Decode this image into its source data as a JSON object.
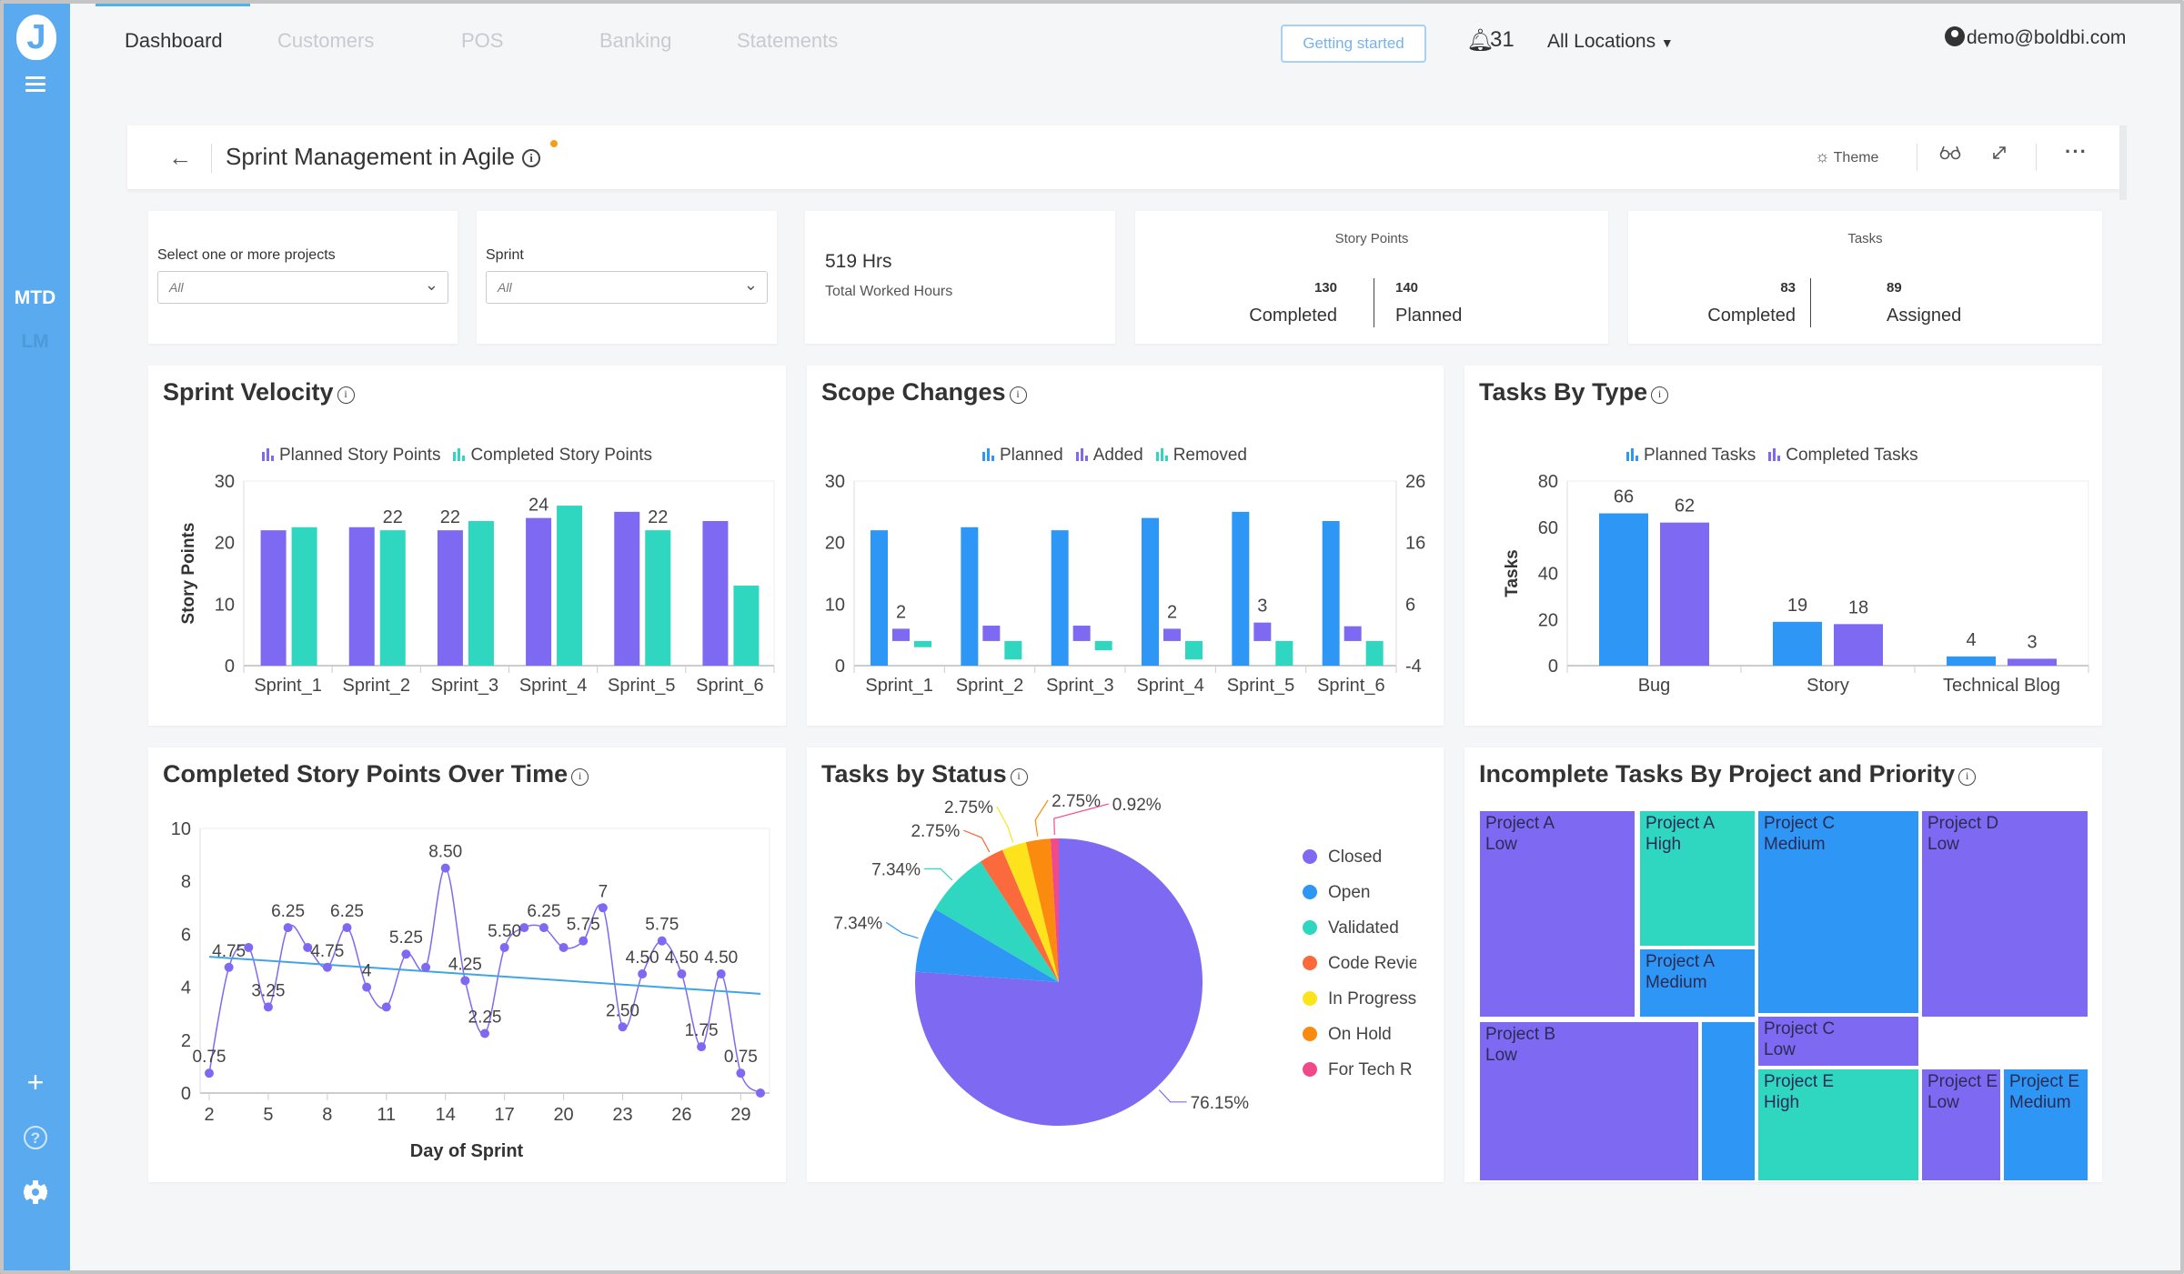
{
  "sidebar": {
    "logo_letter": "J",
    "items": [
      {
        "label": "MTD",
        "active": true
      },
      {
        "label": "LM",
        "active": false
      }
    ],
    "bottom_icons": [
      "plus-icon",
      "help-icon",
      "gear-icon"
    ]
  },
  "topnav": {
    "tabs": [
      {
        "label": "Dashboard",
        "active": true
      },
      {
        "label": "Customers",
        "active": false
      },
      {
        "label": "POS",
        "active": false
      },
      {
        "label": "Banking",
        "active": false
      },
      {
        "label": "Statements",
        "active": false
      }
    ],
    "getting_started": "Getting started",
    "notifications_count": "31",
    "location": "All Locations",
    "user_email": "demo@boldbi.com"
  },
  "dashboard": {
    "title": "Sprint Management in Agile",
    "theme_label": "Theme"
  },
  "filters": {
    "projects": {
      "label": "Select one or more projects",
      "value": "All"
    },
    "sprint": {
      "label": "Sprint",
      "value": "All"
    }
  },
  "kpis": {
    "hours": {
      "value": "519 Hrs",
      "label": "Total Worked Hours"
    },
    "story_points": {
      "title": "Story Points",
      "completed": "130",
      "completed_label": "Completed",
      "planned": "140",
      "planned_label": "Planned"
    },
    "tasks": {
      "title": "Tasks",
      "completed": "83",
      "completed_label": "Completed",
      "assigned": "89",
      "assigned_label": "Assigned"
    }
  },
  "colors": {
    "purple": "#7e6af2",
    "teal": "#2fd6c0",
    "blue": "#2e96f5",
    "orange_red": "#fa6a3c",
    "yellow": "#fde31c",
    "orange": "#fb8b0e",
    "pink": "#f04a8a",
    "trend": "#3fa5e6",
    "sidebar": "#5aaaf0"
  },
  "chart_data": [
    {
      "id": "sprint_velocity",
      "type": "bar",
      "title": "Sprint Velocity",
      "xlabel": "",
      "ylabel": "Story Points",
      "ylim": [
        0,
        30
      ],
      "yticks": [
        0,
        10,
        20,
        30
      ],
      "categories": [
        "Sprint_1",
        "Sprint_2",
        "Sprint_3",
        "Sprint_4",
        "Sprint_5",
        "Sprint_6"
      ],
      "series": [
        {
          "name": "Planned Story Points",
          "color": "#7e6af2",
          "values": [
            22,
            22.5,
            22,
            24,
            25,
            23.5
          ]
        },
        {
          "name": "Completed Story Points",
          "color": "#2fd6c0",
          "values": [
            22.5,
            22,
            23.5,
            26,
            22,
            13
          ]
        }
      ],
      "data_labels": [
        {
          "category": "Sprint_2",
          "series": 1,
          "text": "22"
        },
        {
          "category": "Sprint_3",
          "series": 0,
          "text": "22"
        },
        {
          "category": "Sprint_4",
          "series": 0,
          "text": "24"
        },
        {
          "category": "Sprint_5",
          "series": 1,
          "text": "22"
        }
      ],
      "legend": "top",
      "grid": false
    },
    {
      "id": "scope_changes",
      "type": "bar",
      "title": "Scope Changes",
      "ylim": [
        0,
        30
      ],
      "yticks": [
        0,
        10,
        20,
        30
      ],
      "y2lim": [
        -4,
        26
      ],
      "y2ticks": [
        -4,
        6,
        16,
        26
      ],
      "categories": [
        "Sprint_1",
        "Sprint_2",
        "Sprint_3",
        "Sprint_4",
        "Sprint_5",
        "Sprint_6"
      ],
      "series": [
        {
          "name": "Planned",
          "color": "#2e96f5",
          "axis": "primary",
          "values": [
            22,
            22.5,
            22,
            24,
            25,
            23.5
          ]
        },
        {
          "name": "Added",
          "color": "#7e6af2",
          "axis": "secondary",
          "values": [
            2,
            2.5,
            2.5,
            2,
            3,
            2.4
          ]
        },
        {
          "name": "Removed",
          "color": "#2fd6c0",
          "axis": "secondary",
          "values": [
            -1,
            -3,
            -1.5,
            -3,
            -4,
            -4
          ]
        }
      ],
      "data_labels": [
        {
          "category": "Sprint_1",
          "series": 1,
          "text": "2"
        },
        {
          "category": "Sprint_4",
          "series": 1,
          "text": "2"
        },
        {
          "category": "Sprint_5",
          "series": 1,
          "text": "3"
        }
      ],
      "legend": "top",
      "grid": false
    },
    {
      "id": "tasks_by_type",
      "type": "bar",
      "title": "Tasks By Type",
      "ylabel": "Tasks",
      "ylim": [
        0,
        80
      ],
      "yticks": [
        0,
        20,
        40,
        60,
        80
      ],
      "categories": [
        "Bug",
        "Story",
        "Technical Blog"
      ],
      "series": [
        {
          "name": "Planned Tasks",
          "color": "#2e96f5",
          "values": [
            66,
            19,
            4
          ]
        },
        {
          "name": "Completed Tasks",
          "color": "#7e6af2",
          "values": [
            62,
            18,
            3
          ]
        }
      ],
      "legend": "top",
      "grid": false
    },
    {
      "id": "completed_over_time",
      "type": "line",
      "title": "Completed Story Points Over Time",
      "xlabel": "Day of Sprint",
      "ylabel": "",
      "xlim": [
        2,
        30
      ],
      "xticks": [
        2,
        5,
        8,
        11,
        14,
        17,
        20,
        23,
        26,
        29
      ],
      "ylim": [
        0,
        10
      ],
      "yticks": [
        0,
        2,
        4,
        6,
        8,
        10
      ],
      "x": [
        2,
        3,
        4,
        5,
        6,
        7,
        8,
        9,
        10,
        11,
        12,
        13,
        14,
        15,
        16,
        17,
        18,
        19,
        20,
        21,
        22,
        23,
        24,
        25,
        26,
        27,
        28,
        29,
        30
      ],
      "series": [
        {
          "name": "Completed Story Points",
          "color": "#7e6af2",
          "values": [
            0.75,
            4.75,
            5.5,
            3.25,
            6.25,
            5.5,
            4.75,
            6.25,
            4,
            3.25,
            5.25,
            4.75,
            8.5,
            4.25,
            2.25,
            5.5,
            6.25,
            6.25,
            5.5,
            5.75,
            7,
            2.5,
            4.5,
            5.75,
            4.5,
            1.75,
            4.5,
            0.75,
            0
          ]
        }
      ],
      "trendline": {
        "color": "#3fa5e6",
        "start": [
          2,
          5.15
        ],
        "end": [
          30,
          3.75
        ]
      },
      "data_labels": [
        {
          "x": 2,
          "text": "0.75"
        },
        {
          "x": 3,
          "text": "4.75"
        },
        {
          "x": 5,
          "text": "3.25"
        },
        {
          "x": 6,
          "text": "6.25"
        },
        {
          "x": 8,
          "text": "4.75"
        },
        {
          "x": 9,
          "text": "6.25"
        },
        {
          "x": 10,
          "text": "4"
        },
        {
          "x": 12,
          "text": "5.25"
        },
        {
          "x": 14,
          "text": "8.50"
        },
        {
          "x": 15,
          "text": "4.25"
        },
        {
          "x": 16,
          "text": "2.25"
        },
        {
          "x": 17,
          "text": "5.50"
        },
        {
          "x": 19,
          "text": "6.25"
        },
        {
          "x": 21,
          "text": "5.75"
        },
        {
          "x": 22,
          "text": "7"
        },
        {
          "x": 23,
          "text": "2.50"
        },
        {
          "x": 24,
          "text": "4.50"
        },
        {
          "x": 25,
          "text": "5.75"
        },
        {
          "x": 26,
          "text": "4.50"
        },
        {
          "x": 27,
          "text": "1.75"
        },
        {
          "x": 28,
          "text": "4.50"
        },
        {
          "x": 29,
          "text": "0.75"
        }
      ],
      "grid": false
    },
    {
      "id": "tasks_by_status",
      "type": "pie",
      "title": "Tasks by Status",
      "slices": [
        {
          "label": "Closed",
          "legend_label": "Closed",
          "value": 76.15,
          "text": "76.15%",
          "color": "#7e6af2"
        },
        {
          "label": "Open",
          "legend_label": "Open",
          "value": 7.34,
          "text": "7.34%",
          "color": "#2e96f5"
        },
        {
          "label": "Validated",
          "legend_label": "Validated",
          "value": 7.34,
          "text": "7.34%",
          "color": "#2fd6c0"
        },
        {
          "label": "Code Review",
          "legend_label": "Code Revie",
          "value": 2.75,
          "text": "2.75%",
          "color": "#fa6a3c"
        },
        {
          "label": "In Progress",
          "legend_label": "In Progress",
          "value": 2.75,
          "text": "2.75%",
          "color": "#fde31c"
        },
        {
          "label": "On Hold",
          "legend_label": "On Hold",
          "value": 2.75,
          "text": "2.75%",
          "color": "#fb8b0e"
        },
        {
          "label": "For Tech Review",
          "legend_label": "For Tech R",
          "value": 0.92,
          "text": "0.92%",
          "color": "#f04a8a"
        }
      ],
      "legend": "right"
    },
    {
      "id": "incomplete_tasks_treemap",
      "type": "heatmap",
      "subtype": "treemap",
      "title": "Incomplete Tasks By Project and Priority",
      "cells": [
        {
          "project": "Project A",
          "priority": "Low",
          "color": "#7e6af2"
        },
        {
          "project": "Project A",
          "priority": "High",
          "color": "#2fd6c0"
        },
        {
          "project": "Project A",
          "priority": "Medium",
          "color": "#2e96f5"
        },
        {
          "project": "Project C",
          "priority": "Medium",
          "color": "#2e96f5"
        },
        {
          "project": "Project D",
          "priority": "Low",
          "color": "#7e6af2"
        },
        {
          "project": "Project B",
          "priority": "Low",
          "color": "#7e6af2"
        },
        {
          "project": "Project B",
          "priority": "Medium",
          "color": "#2e96f5",
          "label_hidden": true
        },
        {
          "project": "Project C",
          "priority": "Low",
          "color": "#7e6af2"
        },
        {
          "project": "Project E",
          "priority": "High",
          "color": "#2fd6c0"
        },
        {
          "project": "Project E",
          "priority": "Low",
          "color": "#7e6af2"
        },
        {
          "project": "Project E",
          "priority": "Medium",
          "color": "#2e96f5"
        }
      ]
    }
  ]
}
